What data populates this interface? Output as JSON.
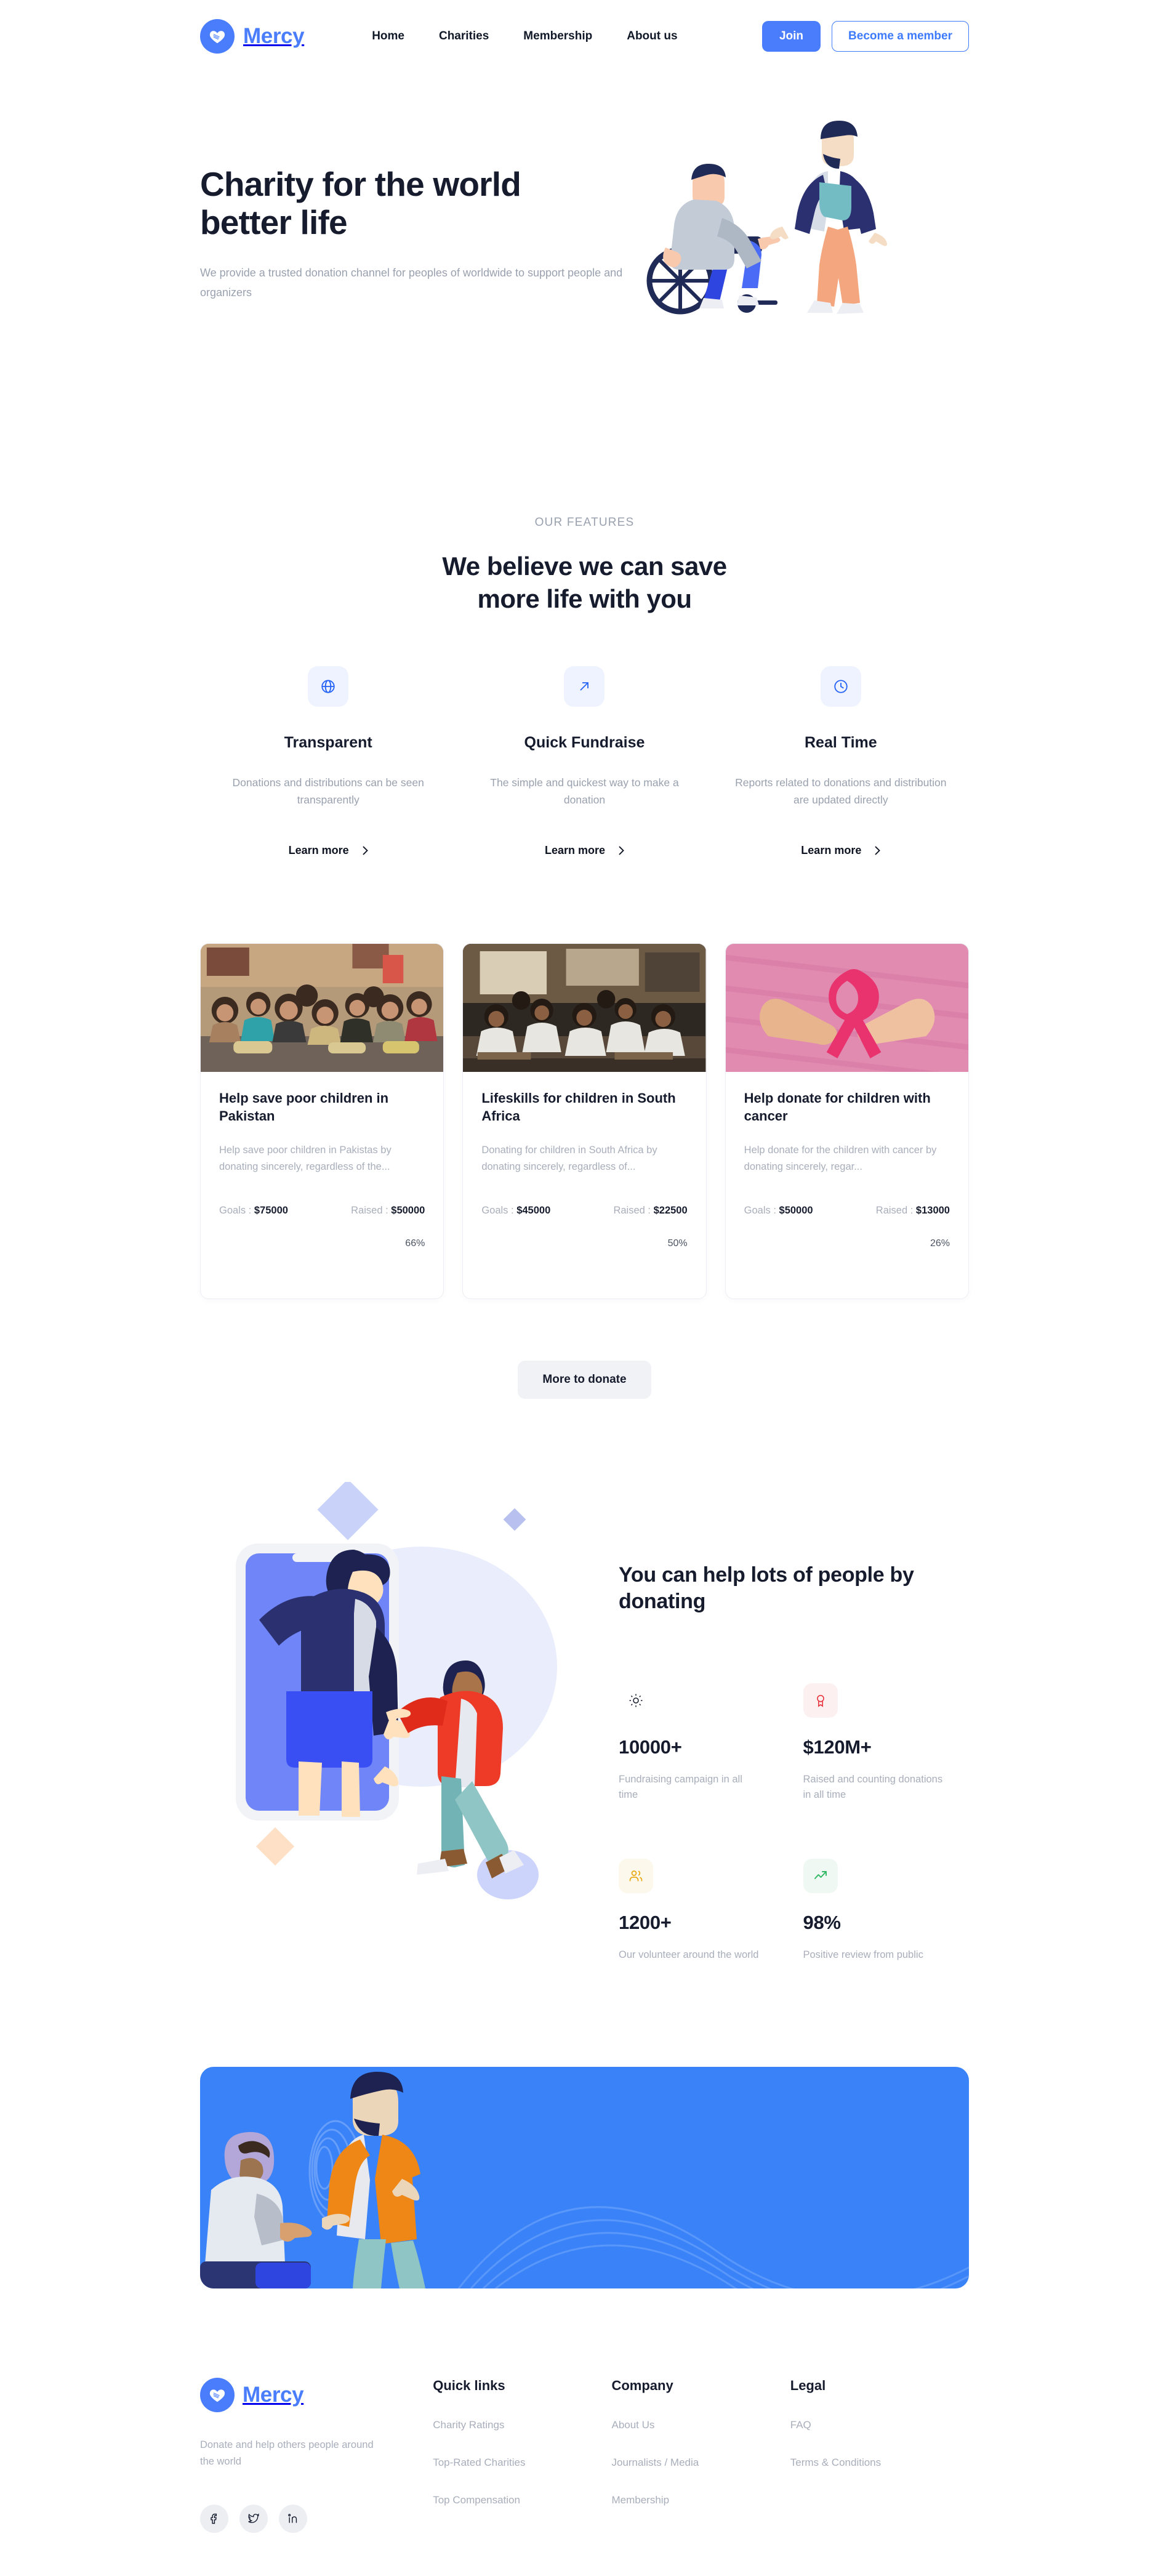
{
  "colors": {
    "brand_blue": "#4a7dfc",
    "dark_navy": "#161c2d",
    "muted_gray": "#a8aeba",
    "banner_blue": "#3a82f7",
    "icon_tile_blue": "#eef3ff",
    "stat_red": "#e8313a",
    "stat_yellow": "#e9a613",
    "stat_green": "#2fb863"
  },
  "header": {
    "brand_name": "Mercy",
    "nav": [
      {
        "label": "Home"
      },
      {
        "label": "Charities"
      },
      {
        "label": "Membership"
      },
      {
        "label": "About us"
      }
    ],
    "join_label": "Join",
    "member_label": "Become a member"
  },
  "hero": {
    "title_line1": "Charity for the world",
    "title_line2": "better life",
    "subtitle": "We provide a trusted donation channel for peoples of worldwide to support people and organizers"
  },
  "features": {
    "eyebrow": "OUR FEATURES",
    "title_line1": "We believe we can save",
    "title_line2": "more life with you",
    "items": [
      {
        "icon": "globe-icon",
        "name": "Transparent",
        "desc": "Donations and distributions can be seen transparently",
        "link_label": "Learn more"
      },
      {
        "icon": "arrow-up-right-icon",
        "name": "Quick Fundraise",
        "desc": "The simple and quickest way to make a donation",
        "link_label": "Learn more"
      },
      {
        "icon": "clock-icon",
        "name": "Real Time",
        "desc": "Reports related to donations and distribution are updated directly",
        "link_label": "Learn more"
      }
    ]
  },
  "campaigns": {
    "cards": [
      {
        "title": "Help save poor children in Pakistan",
        "desc": "Help save poor children in Pakistas by donating sincerely, regardless of the...",
        "goals_label": "Goals :",
        "goals_value": "$75000",
        "raised_label": "Raised :",
        "raised_value": "$50000",
        "percent": "66%",
        "percent_num": 66,
        "image_alt": "children-sitting-classroom-photo"
      },
      {
        "title": "Lifeskills for children in South Africa",
        "desc": "Donating for children in South Africa by donating sincerely, regardless of...",
        "goals_label": "Goals :",
        "goals_value": "$45000",
        "raised_label": "Raised :",
        "raised_value": "$22500",
        "percent": "50%",
        "percent_num": 50,
        "image_alt": "children-in-school-photo"
      },
      {
        "title": "Help donate for children with cancer",
        "desc": "Help donate for the children with cancer by donating sincerely, regar...",
        "goals_label": "Goals :",
        "goals_value": "$50000",
        "raised_label": "Raised :",
        "raised_value": "$13000",
        "percent": "26%",
        "percent_num": 26,
        "image_alt": "pink-ribbon-cancer-awareness-photo"
      }
    ],
    "more_label": "More to donate"
  },
  "donate": {
    "title_line1": "You can help lots of people by",
    "title_line2": "donating",
    "stats": [
      {
        "icon": "sun-icon",
        "icon_bg": "#ffffff",
        "icon_color": "#161c2d",
        "value": "10000+",
        "label": "Fundraising campaign in all time"
      },
      {
        "icon": "award-ribbon-icon",
        "icon_bg": "#fdf0f1",
        "icon_color": "#e8313a",
        "value": "$120M+",
        "label": "Raised and counting donations in all time"
      },
      {
        "icon": "users-icon",
        "icon_bg": "#fdf8ec",
        "icon_color": "#e9a613",
        "value": "1200+",
        "label": "Our volunteer around the world"
      },
      {
        "icon": "trending-up-icon",
        "icon_bg": "#eff8f2",
        "icon_color": "#2fb863",
        "value": "98%",
        "label": "Positive review from public"
      }
    ]
  },
  "footer": {
    "brand_name": "Mercy",
    "tagline": "Donate and help others people around the world",
    "socials": [
      {
        "icon": "facebook-icon"
      },
      {
        "icon": "twitter-icon"
      },
      {
        "icon": "linkedin-icon"
      }
    ],
    "columns": [
      {
        "head": "Quick links",
        "links": [
          {
            "label": "Charity Ratings"
          },
          {
            "label": "Top-Rated Charities"
          },
          {
            "label": "Top Compensation"
          }
        ]
      },
      {
        "head": "Company",
        "links": [
          {
            "label": "About Us"
          },
          {
            "label": "Journalists / Media"
          },
          {
            "label": "Membership"
          }
        ]
      },
      {
        "head": "Legal",
        "links": [
          {
            "label": "FAQ"
          },
          {
            "label": "Terms & Conditions"
          }
        ]
      }
    ]
  }
}
